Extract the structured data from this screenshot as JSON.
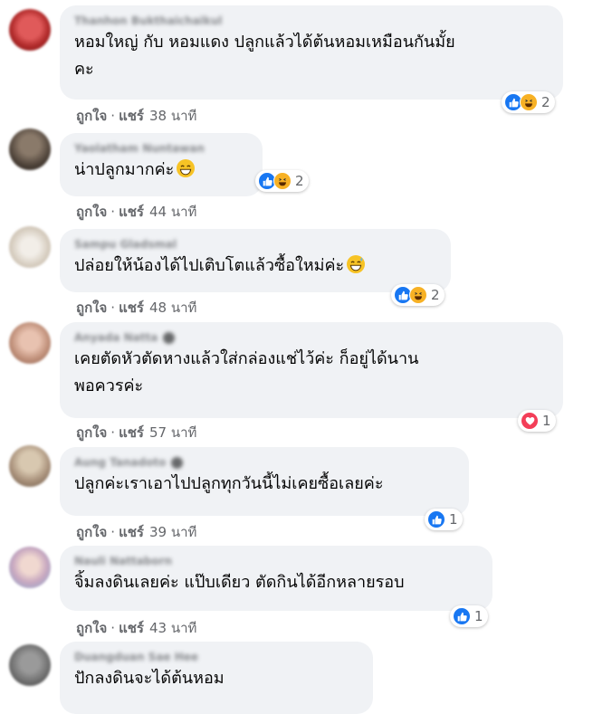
{
  "comments": [
    {
      "name": "Thanhon Bukthaichaikul",
      "text": "หอมใหญ่ กับ หอมแดง ปลูกแล้วได้ต้นหอมเหมือนกันมั้ย\nคะ",
      "reactions": [
        "like",
        "haha"
      ],
      "count": "2",
      "time": "38 นาที"
    },
    {
      "name": "Yaolatham Nuntawan",
      "text": "น่าปลูกมากค่ะ",
      "emoji": "grin",
      "reactions": [
        "like",
        "haha"
      ],
      "count": "2",
      "time": "44 นาที"
    },
    {
      "name": "Sampu Gladsmal",
      "text": "ปล่อยให้น้องได้ไปเติบโตแล้วซื้อใหม่ค่ะ",
      "emoji": "sweat-smile",
      "reactions": [
        "like",
        "haha"
      ],
      "count": "2",
      "time": "48 นาที"
    },
    {
      "name": "Anyada Natta",
      "text": "เคยตัดหัวตัดหางแล้วใส่กล่องแช่ไว้ค่ะ ก็อยู่ได้นาน\nพอควรค่ะ",
      "reactions": [
        "love"
      ],
      "count": "1",
      "time": "57 นาที"
    },
    {
      "name": "Aung Tanadoto",
      "text": "ปลูกค่ะเราเอาไปปลูกทุกวันนี้ไม่เคยซื้อเลยค่ะ",
      "reactions": [
        "like"
      ],
      "count": "1",
      "time": "39 นาที"
    },
    {
      "name": "Nauli Nattaborn",
      "text": "จิ้มลงดินเลยค่ะ แป๊บเดียว ตัดกินได้อีกหลายรอบ",
      "reactions": [
        "like"
      ],
      "count": "1",
      "time": "43 นาที"
    },
    {
      "name": "Duangduan Sae Hee",
      "text": "ปักลงดินจะได้ต้นหอม"
    }
  ],
  "actions": {
    "like": "ถูกใจ",
    "share": "แชร์",
    "dot": "·"
  },
  "colors": {
    "bubble": "#f0f2f5",
    "like": "#1877f2",
    "haha": "#f7b125",
    "love": "#f33e58",
    "meta": "#65676b"
  }
}
